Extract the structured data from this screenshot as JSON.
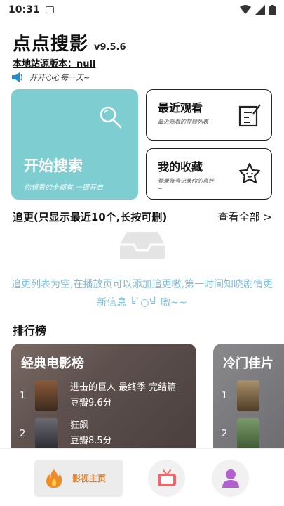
{
  "status_bar": {
    "time": "10:31"
  },
  "header": {
    "app_name": "点点搜影",
    "version": "v9.5.6",
    "source_version": "本地站源版本：null",
    "notice": "开开心心每一天~"
  },
  "cards": {
    "search": {
      "title": "开始搜索",
      "subtitle": "你想看的全都有,一键开启"
    },
    "recent": {
      "title": "最近观看",
      "subtitle": "最近观看的视频列表~"
    },
    "favorites": {
      "title": "我的收藏",
      "subtitle": "登录账号记录你的喜好~"
    }
  },
  "follow": {
    "title": "追更(只显示最近10个,长按可删)",
    "view_all": "查看全部 >",
    "empty_message": "追更列表为空,在播放页可以添加追更嗷,第一时间知晓剧情更新信息 ╘`○'╛ 嗷~~"
  },
  "rankings": {
    "title": "排行榜",
    "lists": [
      {
        "name": "经典电影榜",
        "items": [
          {
            "rank": "1",
            "title": "进击的巨人 最终季 完结篇",
            "score": "豆瓣9.6分"
          },
          {
            "rank": "2",
            "title": "狂飙",
            "score": "豆瓣8.5分"
          }
        ]
      },
      {
        "name": "冷门佳片",
        "items": [
          {
            "rank": "1",
            "title": "",
            "score": ""
          },
          {
            "rank": "2",
            "title": "",
            "score": ""
          }
        ]
      }
    ]
  },
  "bottom_nav": {
    "home_label": "影视主页",
    "accent": "#e0802c",
    "tv_color": "#e86a6a",
    "user_color": "#b25fcf"
  },
  "colors": {
    "search_card": "#7ecdd0",
    "empty_text": "#7fbcd6"
  }
}
